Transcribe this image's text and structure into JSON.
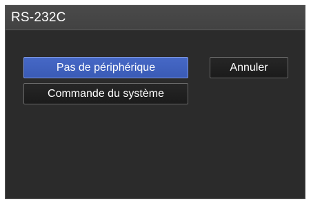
{
  "window": {
    "title": "RS-232C"
  },
  "options": {
    "no_device_label": "Pas de périphérique",
    "system_command_label": "Commande du système"
  },
  "actions": {
    "cancel_label": "Annuler"
  },
  "colors": {
    "selected_accent": "#4262c0",
    "panel_background": "#2b2b2b",
    "title_bar": "#474747"
  }
}
